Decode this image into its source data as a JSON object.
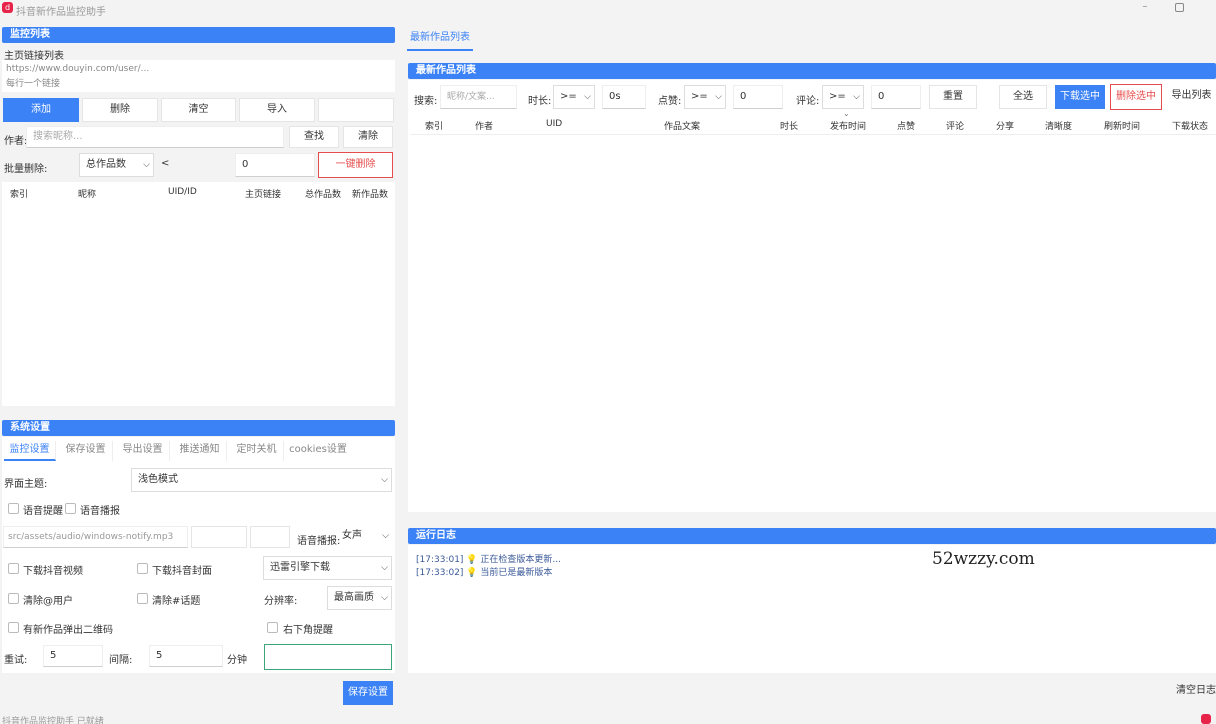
{
  "window": {
    "title": "抖音新作品监控助手",
    "icon": "d"
  },
  "monitor": {
    "header": "监控列表",
    "homepage_links_label": "主页链接列表",
    "link_placeholder_line1": "https://www.douyin.com/user/...",
    "link_placeholder_line2": "每行一个链接",
    "buttons": {
      "add": "添加",
      "delete": "删除",
      "clear": "清空",
      "import": "导入"
    },
    "author_label": "作者:",
    "author_placeholder": "搜索昵称...",
    "search_btn": "查找",
    "clear_btn": "清除",
    "batch_delete_label": "批量删除:",
    "batch_field": "总作品数",
    "batch_op": "<",
    "batch_value": "0",
    "one_click_delete": "一键删除",
    "columns": [
      "索引",
      "昵称",
      "UID/ID",
      "主页链接",
      "总作品数",
      "新作品数"
    ]
  },
  "settings": {
    "header": "系统设置",
    "tabs": [
      "监控设置",
      "保存设置",
      "导出设置",
      "推送通知",
      "定时关机",
      "cookies设置"
    ],
    "theme_label": "界面主题:",
    "theme_value": "浅色模式",
    "voice_reminder": "语音提醒",
    "voice_broadcast": "语音播报",
    "sound_path": "src/assets/audio/windows-notify.mp3",
    "voice_broadcast_label": "语音播报:",
    "voice_broadcast_value": "女声",
    "download_video": "下载抖音视频",
    "download_cover": "下载抖音封面",
    "download_engine": "迅雷引擎下载",
    "clear_user": "清除@用户",
    "clear_topic": "清除#话题",
    "resolution_label": "分辨率:",
    "resolution_value": "最高画质",
    "popup_qr": "有新作品弹出二维码",
    "corner_remind": "右下角提醒",
    "retry_label": "重试:",
    "retry_value": "5",
    "interval_label": "间隔:",
    "interval_value": "5",
    "interval_unit": "分钟",
    "save_btn": "保存设置"
  },
  "works": {
    "tab": "最新作品列表",
    "header": "最新作品列表",
    "search_label": "搜索:",
    "search_placeholder": "昵称/文案...",
    "duration_label": "时长:",
    "duration_op": ">=",
    "duration_value": "0s",
    "likes_label": "点赞:",
    "likes_op": ">=",
    "likes_value": "0",
    "comments_label": "评论:",
    "comments_op": ">=",
    "comments_value": "0",
    "reset_btn": "重置",
    "select_all_btn": "全选",
    "download_selected_btn": "下载选中",
    "delete_selected_btn": "删除选中",
    "export_btn": "导出列表",
    "columns": [
      "索引",
      "作者",
      "UID",
      "作品文案",
      "时长",
      "发布时间",
      "点赞",
      "评论",
      "分享",
      "清晰度",
      "刷新时间",
      "下载状态"
    ]
  },
  "log": {
    "header": "运行日志",
    "lines": [
      {
        "time": "[17:33:01]",
        "text": "正在检查版本更新..."
      },
      {
        "time": "[17:33:02]",
        "text": "当前已是最新版本"
      }
    ],
    "watermark": "52wzzy.com",
    "clear_btn": "清空日志"
  },
  "status": {
    "text": "抖音作品监控助手 已就绪"
  }
}
